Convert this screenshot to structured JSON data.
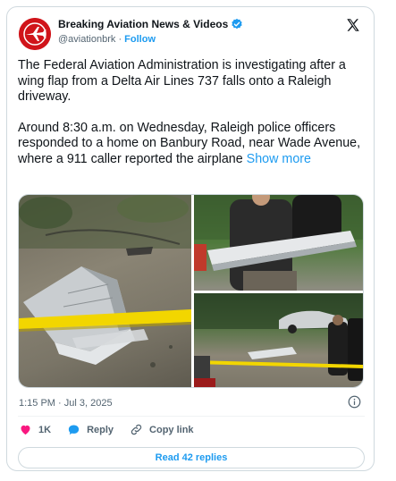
{
  "account": {
    "name": "Breaking Aviation News & Videos",
    "handle": "@aviationbrk",
    "separator": "·",
    "follow_label": "Follow"
  },
  "tweet": {
    "paragraph1": "The Federal Aviation Administration is investigating after a wing flap from a Delta Air Lines 737 falls onto a Raleigh driveway.",
    "paragraph2": "Around 8:30 a.m. on Wednesday, Raleigh police officers responded to a home on Banbury Road, near Wade Avenue, where a 911 caller reported the airplane",
    "show_more_label": "Show more"
  },
  "meta": {
    "time": "1:15 PM",
    "separator": "·",
    "date": "Jul 3, 2025"
  },
  "actions": {
    "like_count": "1K",
    "reply_label": "Reply",
    "copy_link_label": "Copy link"
  },
  "read_replies_label": "Read 42 replies",
  "colors": {
    "accent": "#1d9bf0",
    "like": "#f91880",
    "avatar_bg": "#d0141a"
  },
  "icons": [
    "airplane-logo-icon",
    "verified-badge-icon",
    "x-logo-icon",
    "info-icon",
    "heart-icon",
    "reply-bubble-icon",
    "link-icon"
  ]
}
